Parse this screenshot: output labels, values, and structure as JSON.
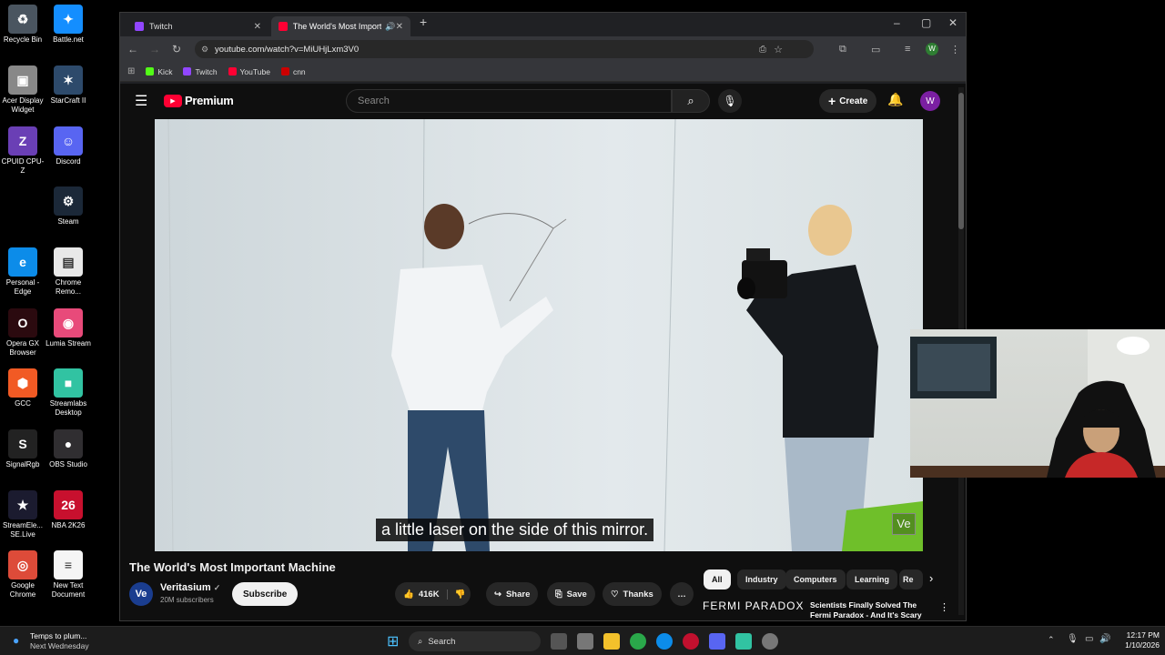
{
  "desktop_icons": [
    {
      "label": "Recycle Bin",
      "glyph": "♻",
      "bg": "#4a5560"
    },
    {
      "label": "Battle.net",
      "glyph": "✦",
      "bg": "#148eff"
    },
    {
      "label": "Acer Display Widget",
      "glyph": "▣",
      "bg": "#888"
    },
    {
      "label": "StarCraft II",
      "glyph": "✶",
      "bg": "#2d4a6b"
    },
    {
      "label": "CPUID CPU-Z",
      "glyph": "Z",
      "bg": "#6a3fb5"
    },
    {
      "label": "Discord",
      "glyph": "☺",
      "bg": "#5865f2"
    },
    {
      "label": "Steam",
      "glyph": "⚙",
      "bg": "#1b2838"
    },
    {
      "label": "Personal - Edge",
      "glyph": "e",
      "bg": "#0c8ce9"
    },
    {
      "label": "Chrome Remo...",
      "glyph": "▤",
      "bg": "#e8e8e8"
    },
    {
      "label": "Opera GX Browser",
      "glyph": "O",
      "bg": "#2b0a0f"
    },
    {
      "label": "Lumia Stream",
      "glyph": "◉",
      "bg": "#e84a7a"
    },
    {
      "label": "GCC",
      "glyph": "⬢",
      "bg": "#f15a24"
    },
    {
      "label": "Streamlabs Desktop",
      "glyph": "■",
      "bg": "#31c3a2"
    },
    {
      "label": "SignalRgb",
      "glyph": "S",
      "bg": "#222"
    },
    {
      "label": "OBS Studio",
      "glyph": "●",
      "bg": "#302e31"
    },
    {
      "label": "StreamEle... SE.Live",
      "glyph": "★",
      "bg": "#1b1b2f"
    },
    {
      "label": "NBA 2K26",
      "glyph": "26",
      "bg": "#c8102e"
    },
    {
      "label": "Google Chrome",
      "glyph": "◎",
      "bg": "#dd4b39"
    },
    {
      "label": "New Text Document",
      "glyph": "≡",
      "bg": "#f5f5f5"
    }
  ],
  "browser": {
    "tabs": [
      {
        "title": "Twitch",
        "active": false,
        "color": "#9146ff"
      },
      {
        "title": "The World's Most Importar",
        "active": true,
        "color": "#ff0033"
      }
    ],
    "new_tab": "+",
    "window_controls": {
      "minimize": "–",
      "maximize": "▢",
      "close": "✕"
    },
    "nav": {
      "back": "←",
      "forward": "→",
      "reload": "↻"
    },
    "url": "youtube.com/watch?v=MiUHjLxm3V0",
    "profile_initial": "W",
    "bookmarks": [
      {
        "label": "Kick",
        "color": "#53fc18"
      },
      {
        "label": "Twitch",
        "color": "#9146ff"
      },
      {
        "label": "YouTube",
        "color": "#ff0033"
      },
      {
        "label": "cnn",
        "color": "#cc0000"
      }
    ]
  },
  "youtube": {
    "logo_text": "Premium",
    "search_placeholder": "Search",
    "create_label": "Create",
    "avatar_initial": "W",
    "caption": "a little laser on the side of this mirror.",
    "watermark": "Ve",
    "video_title": "The World's Most Important Machine",
    "channel": {
      "name": "Veritasium",
      "subscribers": "20M subscribers",
      "avatar": "Ve"
    },
    "subscribe_label": "Subscribe",
    "likes": "416K",
    "share_label": "Share",
    "save_label": "Save",
    "thanks_label": "Thanks",
    "more_label": "…",
    "chips": [
      "All",
      "Industry",
      "Computers",
      "Learning",
      "Re"
    ],
    "recommended": {
      "thumb_text": "FERMI PARADOX",
      "title": "Scientists Finally Solved The Fermi Paradox - And It's Scary"
    }
  },
  "taskbar": {
    "notification_title": "Temps to plum...",
    "notification_sub": "Next Wednesday",
    "search_label": "Search",
    "time": "12:17 PM",
    "date": "1/10/2026"
  }
}
